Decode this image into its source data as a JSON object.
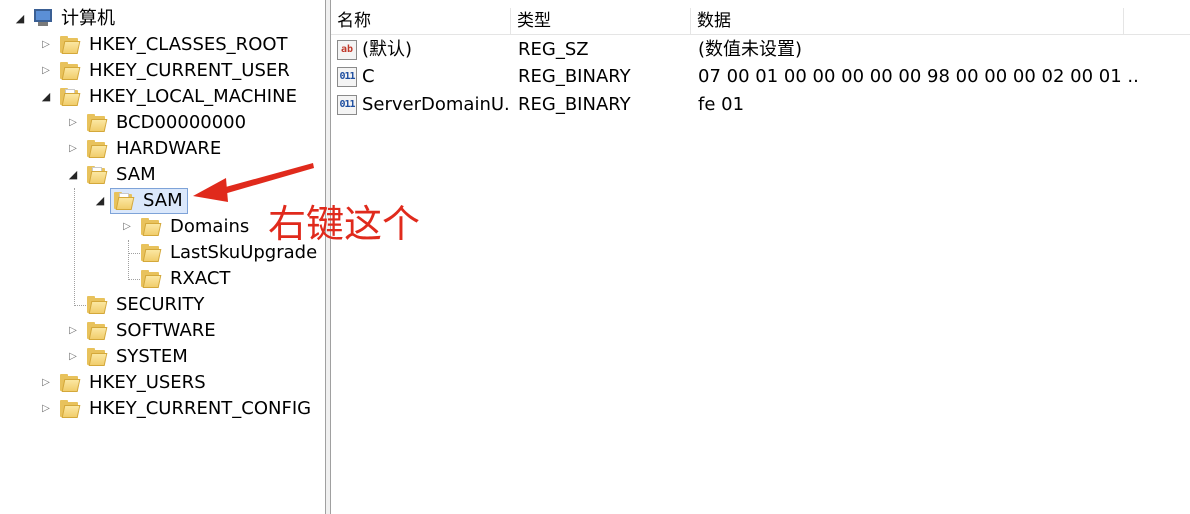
{
  "tree": {
    "root": {
      "label": "计算机",
      "icon": "computer-icon"
    },
    "hives": [
      {
        "label": "HKEY_CLASSES_ROOT",
        "expander": "▷"
      },
      {
        "label": "HKEY_CURRENT_USER",
        "expander": "▷"
      },
      {
        "label": "HKEY_LOCAL_MACHINE",
        "expander": "◢"
      }
    ],
    "hklm_children": [
      {
        "label": "BCD00000000",
        "expander": "▷"
      },
      {
        "label": "HARDWARE",
        "expander": "▷"
      },
      {
        "label": "SAM",
        "expander": "◢"
      }
    ],
    "sam_child": {
      "label": "SAM",
      "expander": "◢"
    },
    "sam_sub": [
      {
        "label": "Domains",
        "expander": "▷"
      },
      {
        "label": "LastSkuUpgrade"
      },
      {
        "label": "RXACT"
      }
    ],
    "hklm_rest": [
      {
        "label": "SECURITY"
      },
      {
        "label": "SOFTWARE",
        "expander": "▷"
      },
      {
        "label": "SYSTEM",
        "expander": "▷"
      }
    ],
    "hives_rest": [
      {
        "label": "HKEY_USERS",
        "expander": "▷"
      },
      {
        "label": "HKEY_CURRENT_CONFIG",
        "expander": "▷"
      }
    ],
    "root_expander": "◢"
  },
  "list": {
    "columns": [
      "名称",
      "类型",
      "数据"
    ],
    "rows": [
      {
        "icon": "string-value-icon",
        "icon_text": "ab",
        "name": "(默认)",
        "type": "REG_SZ",
        "data": "(数值未设置)"
      },
      {
        "icon": "binary-value-icon",
        "icon_text": "011",
        "name": "C",
        "type": "REG_BINARY",
        "data": "07 00 01 00 00 00 00 00 98 00 00 00 02 00 01 ..."
      },
      {
        "icon": "binary-value-icon",
        "icon_text": "011",
        "name": "ServerDomainU...",
        "type": "REG_BINARY",
        "data": "fe 01"
      }
    ]
  },
  "annotation": {
    "text": "右键这个",
    "color": "#e02a1c"
  },
  "colors": {
    "selection_bg": "#dbe8fb",
    "selection_border": "#7ea3d8",
    "folder": "#e8c25c"
  }
}
